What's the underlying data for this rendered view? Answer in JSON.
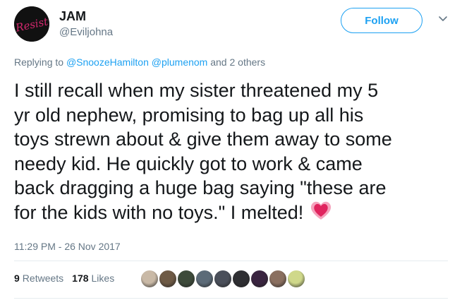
{
  "user": {
    "display_name": "JAM",
    "handle": "@Eviljohna",
    "avatar_text": "Resist"
  },
  "actions": {
    "follow_label": "Follow"
  },
  "reply": {
    "prefix": "Replying to",
    "mention1": "@SnoozeHamilton",
    "mention2": "@plumenom",
    "suffix": "and 2 others"
  },
  "tweet": {
    "lines": [
      "I still recall when my sister threatened my 5",
      "yr old nephew, promising to bag up all his",
      "toys strewn about & give them away to some",
      "needy kid. He quickly got to work & came",
      "back dragging a huge bag saying \"these are",
      "for the kids with no toys.\" I melted!"
    ],
    "emoji": "heart-emoji"
  },
  "timestamp": "11:29 PM - 26 Nov 2017",
  "stats": {
    "retweets_count": "9",
    "retweets_label": "Retweets",
    "likes_count": "178",
    "likes_label": "Likes"
  },
  "likers": [
    {
      "color": "#c9b9a6"
    },
    {
      "color": "#6e5a45"
    },
    {
      "color": "#3d4a3a"
    },
    {
      "color": "#5c6b78"
    },
    {
      "color": "#4a4f5a"
    },
    {
      "color": "#2f2f33"
    },
    {
      "color": "#3a2440"
    },
    {
      "color": "#8a6f5f"
    },
    {
      "color": "#cfd88a"
    }
  ],
  "colors": {
    "accent": "#1da1f2",
    "secondary_text": "#657786",
    "primary_text": "#14171a",
    "heart": "#e0245e"
  }
}
